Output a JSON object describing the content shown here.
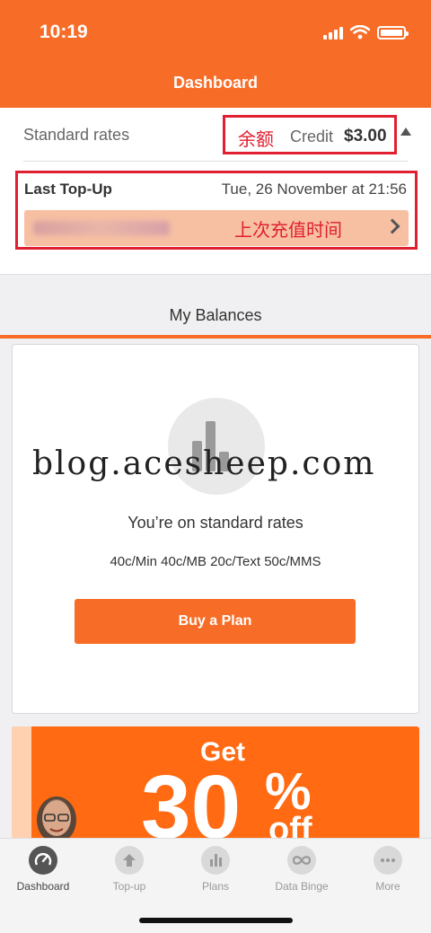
{
  "status_bar": {
    "time": "10:19"
  },
  "header": {
    "title": "Dashboard"
  },
  "summary": {
    "rates_label": "Standard rates",
    "credit_annotation": "余额",
    "credit_label": "Credit",
    "credit_value": "$3.00",
    "last_topup_label": "Last Top-Up",
    "last_topup_date": "Tue, 26 November at 21:56",
    "topup_annotation": "上次充值时间"
  },
  "balances": {
    "section_title": "My Balances",
    "watermark": "blog.acesheep.com",
    "rates_title": "You’re on standard rates",
    "rates_detail": "40c/Min 40c/MB 20c/Text 50c/MMS",
    "buy_button": "Buy a Plan"
  },
  "promo": {
    "get": "Get",
    "number": "30",
    "percent": "%",
    "off": "off"
  },
  "tabs": [
    {
      "label": "Dashboard",
      "icon": "gauge-icon",
      "active": true
    },
    {
      "label": "Top-up",
      "icon": "topup-arrow-icon",
      "active": false
    },
    {
      "label": "Plans",
      "icon": "bar-chart-icon",
      "active": false
    },
    {
      "label": "Data Binge",
      "icon": "infinity-icon",
      "active": false
    },
    {
      "label": "More",
      "icon": "more-dots-icon",
      "active": false
    }
  ],
  "colors": {
    "brand": "#f76d28",
    "annotation": "#e02030"
  }
}
